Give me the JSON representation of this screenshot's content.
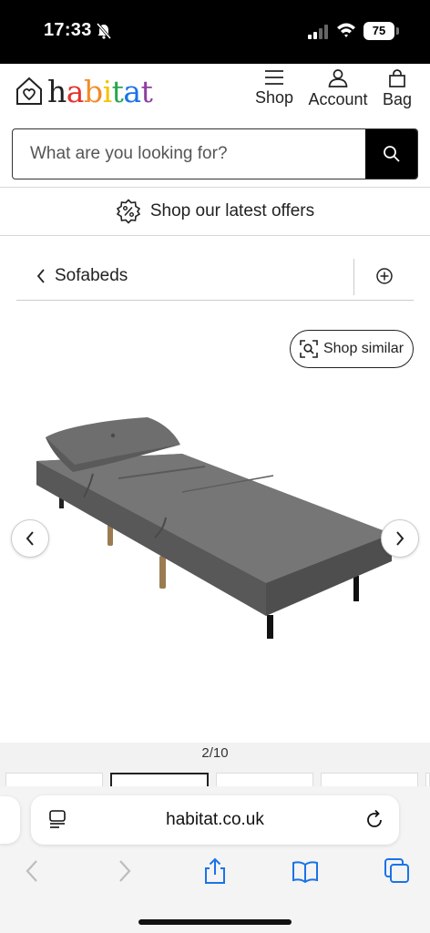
{
  "status_bar": {
    "time": "17:33",
    "battery": "75"
  },
  "header": {
    "logo_text": "habitat",
    "nav": {
      "shop": "Shop",
      "account": "Account",
      "bag": "Bag"
    }
  },
  "search": {
    "placeholder": "What are you looking for?"
  },
  "offers": {
    "label": "Shop our latest offers"
  },
  "breadcrumb": {
    "back_label": "Sofabeds"
  },
  "product": {
    "shop_similar_label": "Shop similar",
    "image_counter": "2/10",
    "sofa_color": "#6a6a6a"
  },
  "browser": {
    "url": "habitat.co.uk",
    "accent_color": "#1a73e8"
  }
}
